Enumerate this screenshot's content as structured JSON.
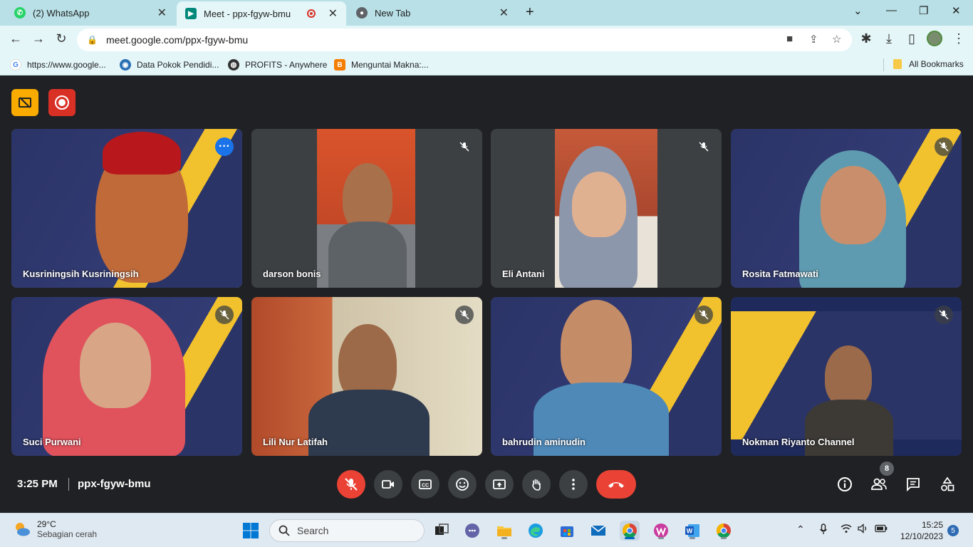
{
  "browser": {
    "tabs": [
      {
        "title": "(2) WhatsApp",
        "favicon": "whatsapp-icon",
        "color": "#25d366",
        "active": false
      },
      {
        "title": "Meet - ppx-fgyw-bmu",
        "favicon": "google-meet-icon",
        "color": "#00897b",
        "active": true
      },
      {
        "title": "New Tab",
        "favicon": "chrome-icon",
        "color": "#5f6368",
        "active": false
      }
    ],
    "url": "meet.google.com/ppx-fgyw-bmu",
    "bookmarks": [
      {
        "label": "https://www.google...",
        "icon": "google-icon"
      },
      {
        "label": "Data Pokok Pendidi...",
        "icon": "dapodik-icon"
      },
      {
        "label": "PROFITS - Anywhere",
        "icon": "globe-icon"
      },
      {
        "label": "Menguntai Makna:...",
        "icon": "blogger-icon"
      }
    ],
    "all_bookmarks": "All Bookmarks"
  },
  "meet": {
    "participants": [
      {
        "name": "Kusriningsih Kusriningsih",
        "speaking": true
      },
      {
        "name": "darson bonis",
        "muted": true
      },
      {
        "name": "Eli Antani",
        "muted": true
      },
      {
        "name": "Rosita Fatmawati",
        "muted": true
      },
      {
        "name": "Suci Purwani",
        "muted": true
      },
      {
        "name": "Lili Nur Latifah",
        "muted": true
      },
      {
        "name": "bahrudin aminudin",
        "muted": true
      },
      {
        "name": "Nokman Riyanto Channel",
        "muted": true
      }
    ],
    "time": "3:25 PM",
    "meeting_code": "ppx-fgyw-bmu",
    "people_count": "8",
    "accent_red": "#ea4335",
    "accent_blue": "#8ab4f8"
  },
  "taskbar": {
    "weather_temp": "29°C",
    "weather_desc": "Sebagian cerah",
    "search_placeholder": "Search",
    "clock_time": "15:25",
    "clock_date": "12/10/2023",
    "notifications": "5"
  }
}
